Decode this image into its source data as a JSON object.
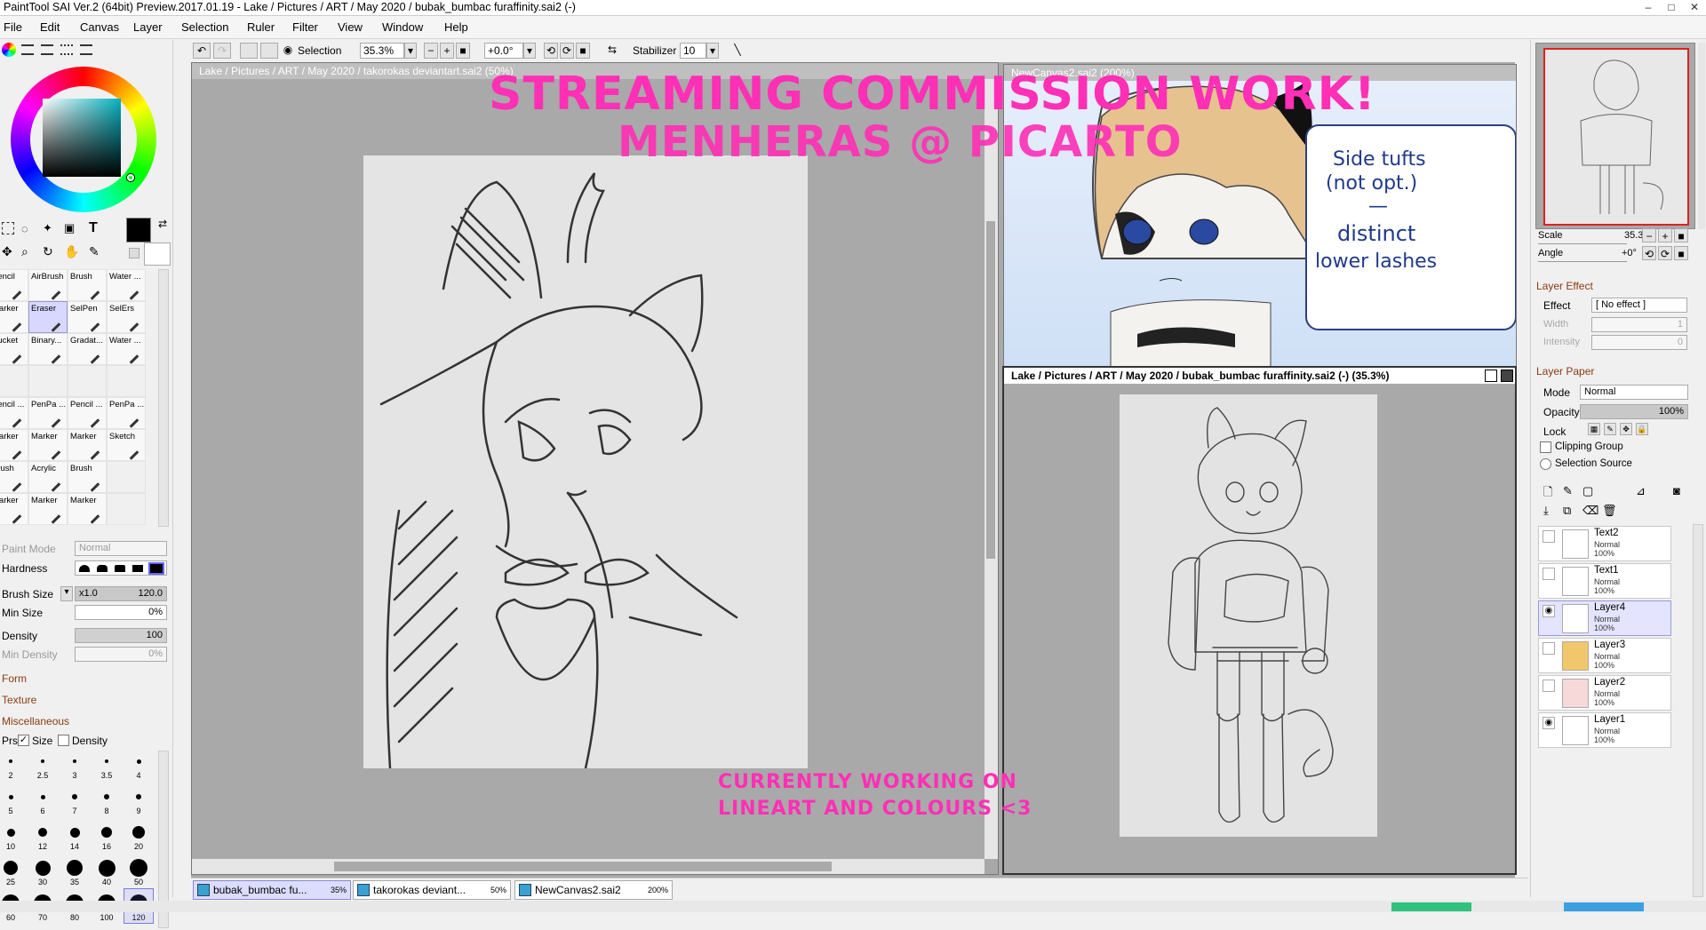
{
  "app": {
    "title": "PaintTool SAI Ver.2 (64bit) Preview.2017.01.19 - Lake / Pictures / ART / May 2020 / bubak_bumbac furaffinity.sai2 (-)"
  },
  "menu": [
    "File",
    "Edit",
    "Canvas",
    "Layer",
    "Selection",
    "Ruler",
    "Filter",
    "View",
    "Window",
    "Help"
  ],
  "toolbar": {
    "selection_label": "Selection",
    "zoom": "35.3%",
    "rotation": "+0.0°",
    "stabilizer_label": "Stabilizer",
    "stabilizer_value": "10"
  },
  "tools": {
    "row1": [
      "Pencil",
      "AirBrush",
      "Brush",
      "Water ..."
    ],
    "row2": [
      "Marker",
      "Eraser",
      "SelPen",
      "SelErs"
    ],
    "row3": [
      "Bucket",
      "Binary...",
      "Gradat...",
      "Water ..."
    ],
    "row4": [
      "Pencil ...",
      "PenPa ...",
      "Pencil ...",
      "PenPa ..."
    ],
    "row5": [
      "Marker",
      "Marker",
      "Marker",
      "Sketch"
    ],
    "row6": [
      "Brush",
      "Acrylic",
      "Brush",
      ""
    ],
    "row7": [
      "Marker",
      "Marker",
      "Marker",
      ""
    ]
  },
  "brushprops": {
    "paint_mode_label": "Paint Mode",
    "paint_mode": "Normal",
    "hardness_label": "Hardness",
    "brush_size_label": "Brush Size",
    "brush_size_mult": "x1.0",
    "brush_size": "120.0",
    "min_size_label": "Min Size",
    "min_size": "0%",
    "density_label": "Density",
    "density": "100",
    "min_density_label": "Min Density",
    "min_density": "0%",
    "form": "Form",
    "texture": "Texture",
    "misc": "Miscellaneous",
    "prs": "Prs",
    "size": "Size",
    "density_check": "Density"
  },
  "brushsizes": [
    "2",
    "2.5",
    "3",
    "3.5",
    "4",
    "5",
    "6",
    "7",
    "8",
    "9",
    "10",
    "12",
    "14",
    "16",
    "20",
    "25",
    "30",
    "35",
    "40",
    "50",
    "60",
    "70",
    "80",
    "100",
    "120"
  ],
  "windows": {
    "w1": "Lake / Pictures / ART / May 2020 / takorokas deviantart.sai2 (50%)",
    "w2": "NewCanvas2.sai2 (200%)",
    "w3": "Lake / Pictures / ART / May 2020 / bubak_bumbac furaffinity.sai2 (-) (35.3%)"
  },
  "overlay": {
    "line1": "STREAMING COMMISSION WORK!",
    "line2": "MENHERAS @ PICARTO",
    "line3": "CURRENTLY WORKING ON",
    "line4": "LINEART AND COLOURS <3"
  },
  "refnote": {
    "l1": "Side tufts",
    "l2": "(not opt.)",
    "l3": "—",
    "l4": "distinct",
    "l5": "lower lashes"
  },
  "navigator": {
    "scale_label": "Scale",
    "scale": "35.3%",
    "angle_label": "Angle",
    "angle": "+0°"
  },
  "layereffect": {
    "header": "Layer Effect",
    "effect_label": "Effect",
    "effect": "[ No effect ]",
    "width_label": "Width",
    "width": "1",
    "intensity_label": "Intensity",
    "intensity": "0"
  },
  "layerpaper": {
    "header": "Layer Paper",
    "mode_label": "Mode",
    "mode": "Normal",
    "opacity_label": "Opacity",
    "opacity": "100%",
    "lock_label": "Lock",
    "clipping": "Clipping Group",
    "selsource": "Selection Source"
  },
  "layers": [
    {
      "name": "Text2",
      "mode": "Normal",
      "opacity": "100%"
    },
    {
      "name": "Text1",
      "mode": "Normal",
      "opacity": "100%"
    },
    {
      "name": "Layer4",
      "mode": "Normal",
      "opacity": "100%"
    },
    {
      "name": "Layer3",
      "mode": "Normal",
      "opacity": "100%"
    },
    {
      "name": "Layer2",
      "mode": "Normal",
      "opacity": "100%"
    },
    {
      "name": "Layer1",
      "mode": "Normal",
      "opacity": "100%"
    }
  ],
  "tabs": [
    {
      "name": "bubak_bumbac fu...",
      "zoom": "35%"
    },
    {
      "name": "takorokas deviant...",
      "zoom": "50%"
    },
    {
      "name": "NewCanvas2.sai2",
      "zoom": "200%"
    }
  ]
}
